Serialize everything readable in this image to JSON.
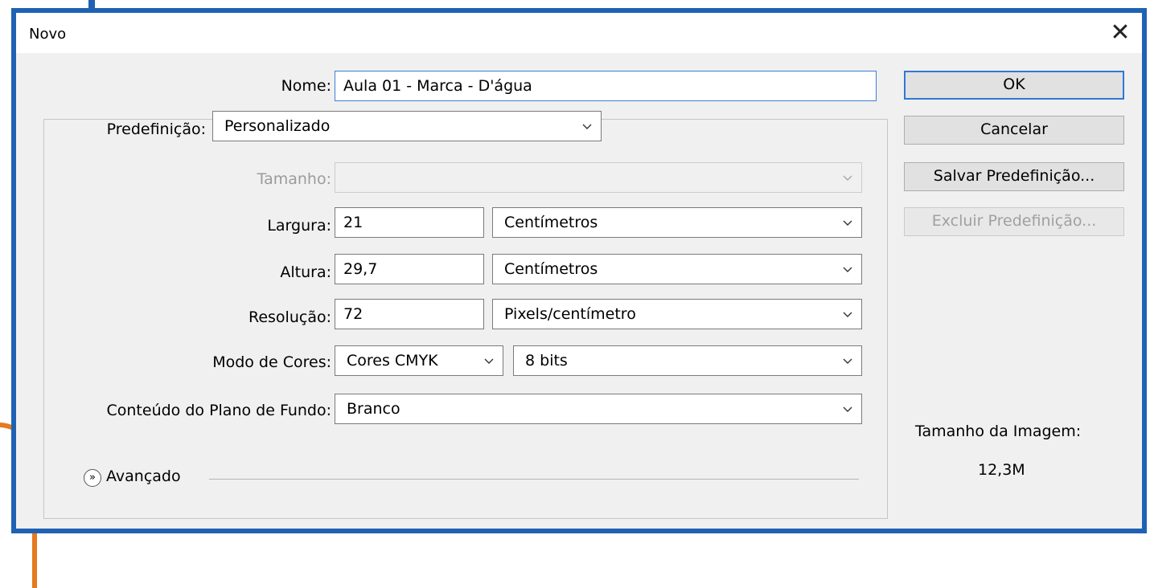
{
  "window": {
    "title": "Novo"
  },
  "form": {
    "nome_label": "Nome:",
    "nome_value": "Aula 01 - Marca - D'água",
    "predefinicao_label": "Predefinição:",
    "predefinicao_value": "Personalizado",
    "tamanho_label": "Tamanho:",
    "tamanho_value": "",
    "largura_label": "Largura:",
    "largura_value": "21",
    "largura_unit": "Centímetros",
    "altura_label": "Altura:",
    "altura_value": "29,7",
    "altura_unit": "Centímetros",
    "resolucao_label": "Resolução:",
    "resolucao_value": "72",
    "resolucao_unit": "Pixels/centímetro",
    "modo_label": "Modo de Cores:",
    "modo_value": "Cores CMYK",
    "bits_value": "8 bits",
    "conteudo_label": "Conteúdo do Plano de Fundo:",
    "conteudo_value": "Branco",
    "avancado_label": "Avançado"
  },
  "buttons": {
    "ok": "OK",
    "cancelar": "Cancelar",
    "salvar": "Salvar Predefinição...",
    "excluir": "Excluir Predefinição..."
  },
  "image_size": {
    "label": "Tamanho da Imagem:",
    "value": "12,3M"
  },
  "colors": {
    "frame": "#1f62b4",
    "accent_orange": "#e67a1f",
    "dialog_bg": "#f0f0f0"
  },
  "icons": [
    "close-icon",
    "chevron-down-icon",
    "expand-advanced-icon"
  ]
}
